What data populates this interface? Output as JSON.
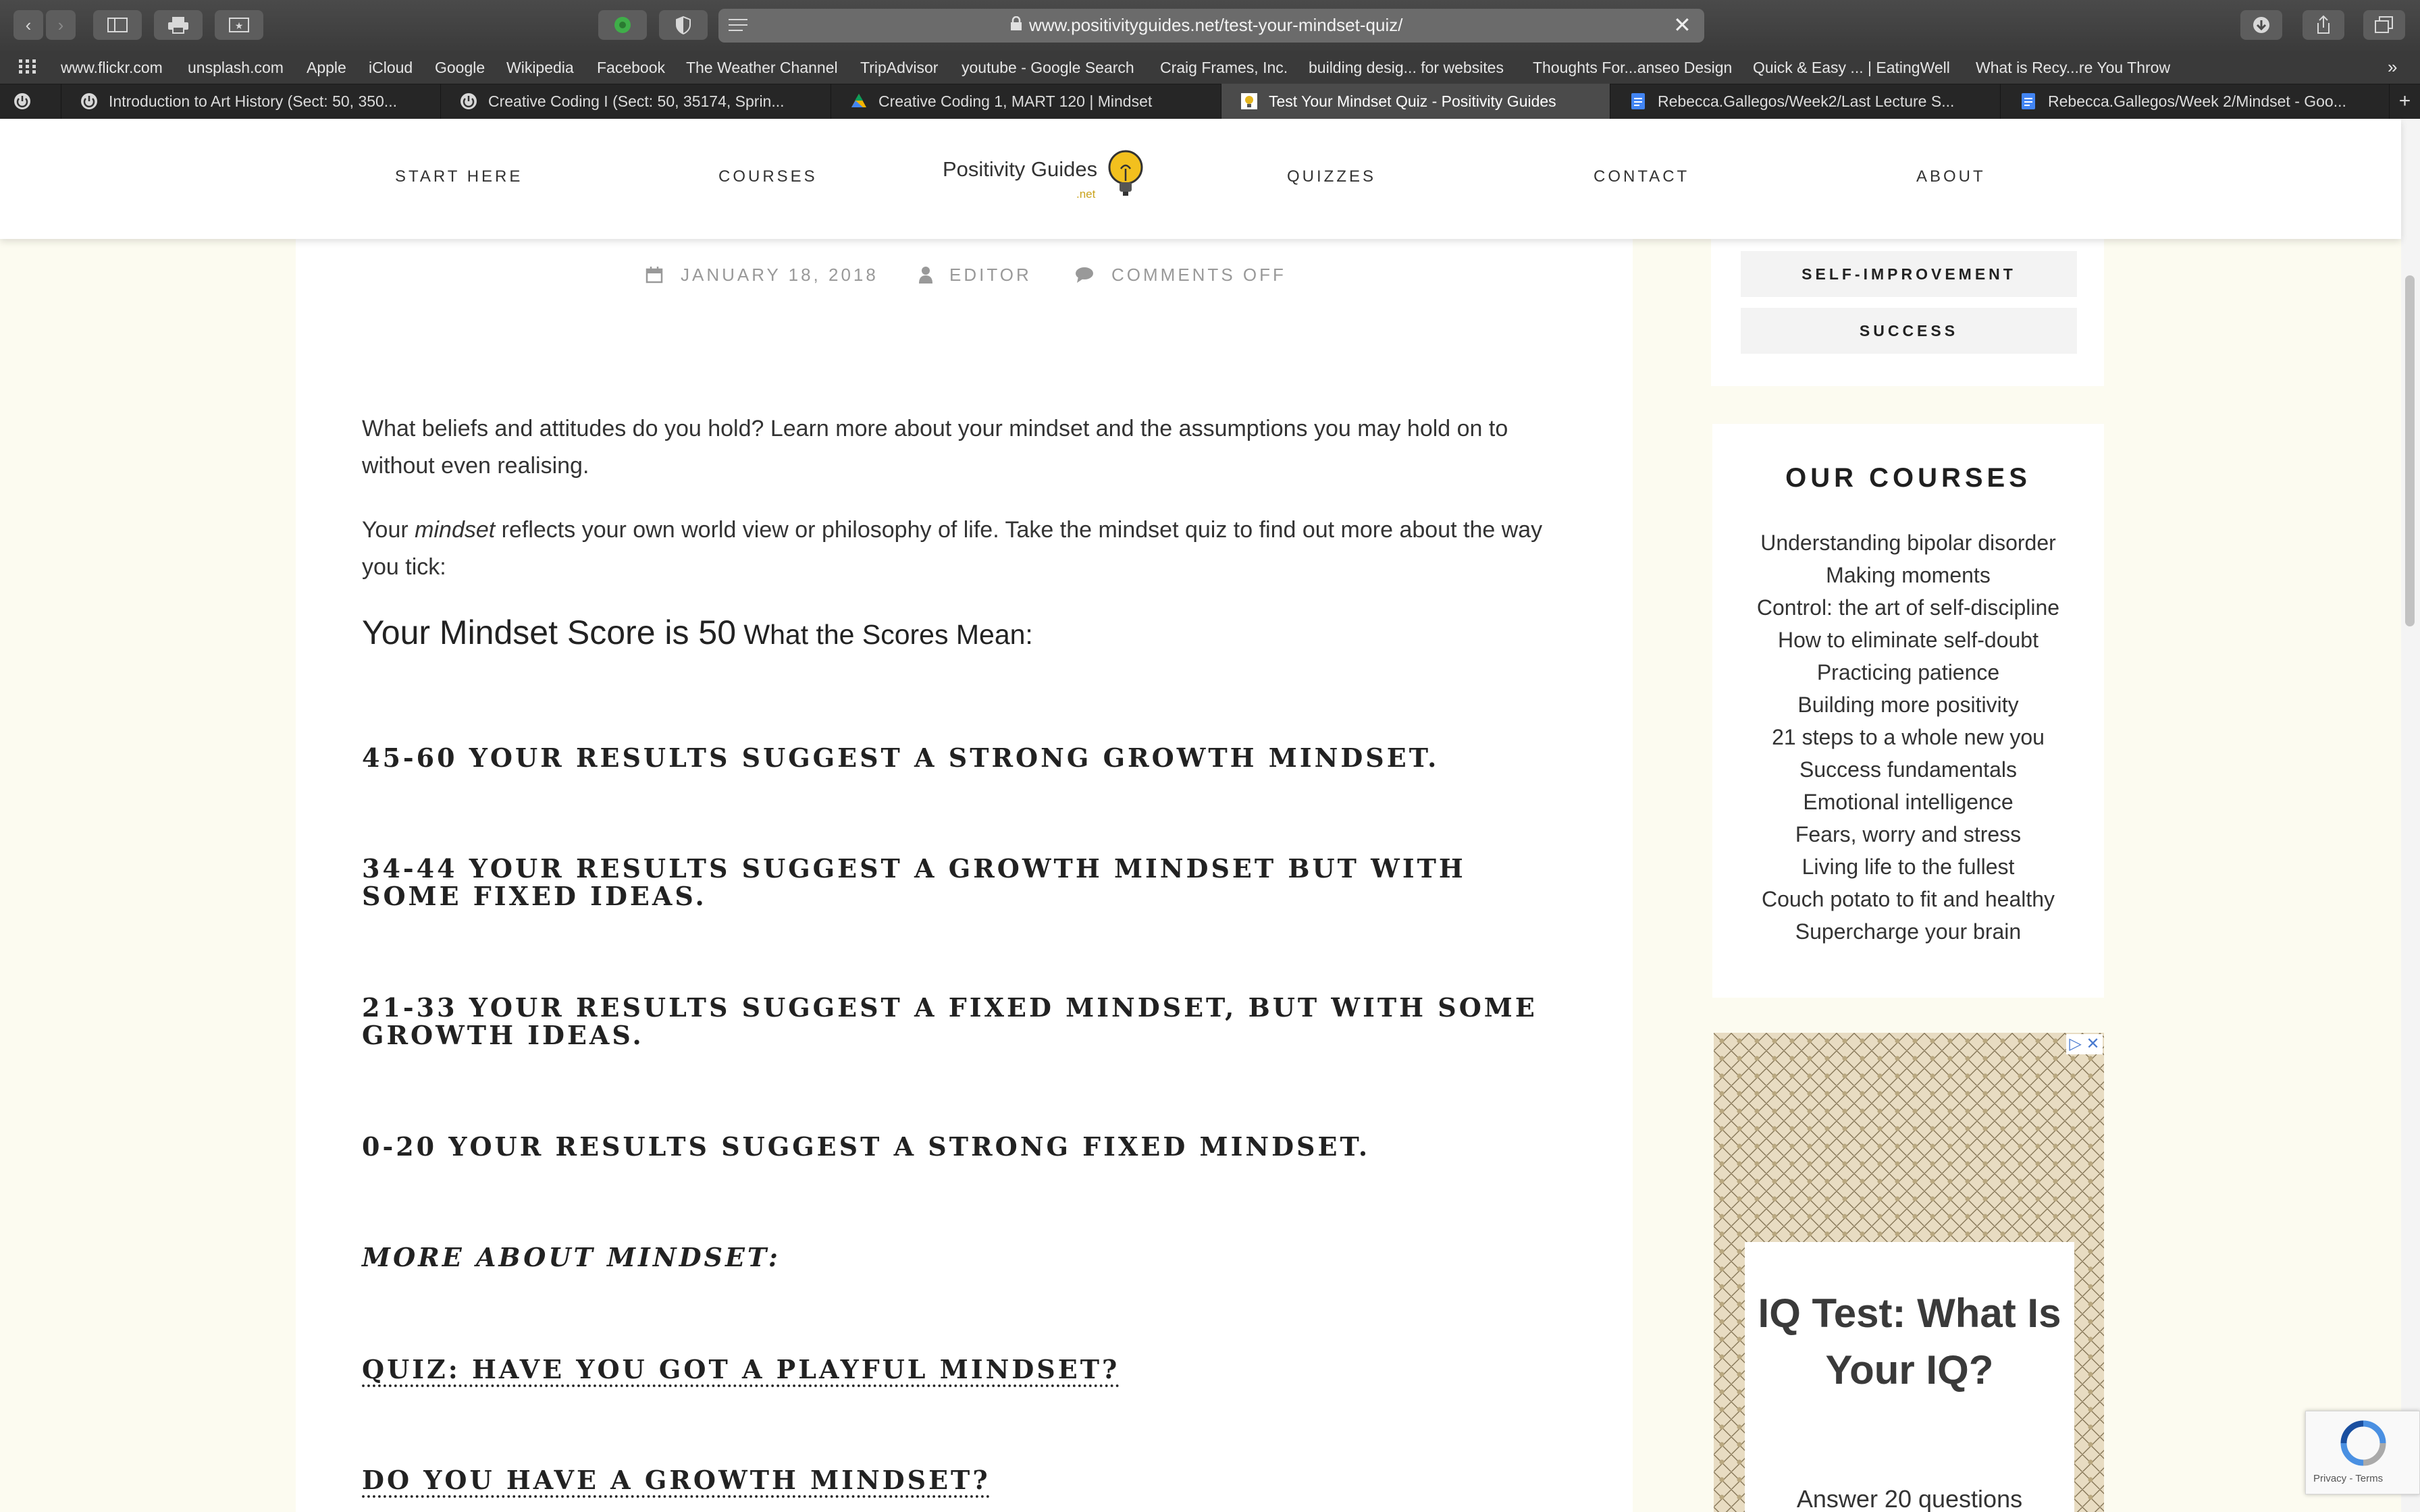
{
  "browser": {
    "url": "www.positivityguides.net/test-your-mindset-quiz/",
    "bookmarks": [
      "www.flickr.com",
      "unsplash.com",
      "Apple",
      "iCloud",
      "Google",
      "Wikipedia",
      "Facebook",
      "The Weather Channel",
      "TripAdvisor",
      "youtube - Google Search",
      "Craig Frames, Inc.",
      "building desig... for websites",
      "Thoughts For...anseo Design",
      "Quick & Easy ... | EatingWell",
      "What is Recy...re You Throw"
    ],
    "tabs": [
      "Introduction to Art History (Sect: 50, 350...",
      "Creative Coding I (Sect: 50, 35174, Sprin...",
      "Creative Coding 1, MART 120 | Mindset",
      "Test Your Mindset Quiz - Positivity Guides",
      "Rebecca.Gallegos/Week2/Last Lecture S...",
      "Rebecca.Gallegos/Week 2/Mindset - Goo..."
    ],
    "active_tab": 3
  },
  "site": {
    "nav_left": [
      "START HERE",
      "COURSES"
    ],
    "nav_right": [
      "QUIZZES",
      "CONTACT",
      "ABOUT"
    ],
    "logo": {
      "name": "Positivity Guides",
      "suffix": ".net"
    }
  },
  "article": {
    "date": "JANUARY 18, 2018",
    "author": "EDITOR",
    "comments": "COMMENTS OFF",
    "intro": "What beliefs and attitudes do you hold? Learn more about your mindset and the assumptions you may hold on to without even realising.",
    "p2_pre": "Your ",
    "p2_em": "mindset",
    "p2_post": " reflects your own world view or philosophy of life. Take the mindset quiz to find out more about the way you tick:",
    "score_label": "Your Mindset Score is ",
    "score_value": "50",
    "scores_mean": " What the Scores Mean:",
    "bands": [
      "45-60 Your results suggest a strong growth mindset.",
      "34-44 Your results suggest a growth mindset but with some fixed ideas.",
      "21-33 Your results suggest a fixed mindset, but with some growth ideas.",
      "0-20 Your results suggest a strong fixed mindset."
    ],
    "more_heading": "More about mindset:",
    "links": [
      "Quiz: Have you got a playful mindset?",
      "Do you have a growth mindset?"
    ]
  },
  "sidebar": {
    "tags": [
      "SELF-IMPROVEMENT",
      "SUCCESS"
    ],
    "courses_title": "OUR COURSES",
    "courses": [
      "Understanding bipolar disorder",
      "Making moments",
      "Control: the art of self-discipline",
      "How to eliminate self-doubt",
      "Practicing patience",
      "Building more positivity",
      "21 steps to a whole new you",
      "Success fundamentals",
      "Emotional intelligence",
      "Fears, worry and stress",
      "Living life to the fullest",
      "Couch potato to fit and healthy",
      "Supercharge your brain"
    ],
    "ad": {
      "title": "IQ Test: What Is Your IQ?",
      "subtitle": "Answer 20 questions",
      "close": "▷ ✕"
    }
  },
  "recaptcha": {
    "text": "Privacy - Terms"
  },
  "colors": {
    "page_bg": "#fcfbf0",
    "logo_accent": "#c9a21b",
    "chrome_dark": "#3a3a3a"
  }
}
